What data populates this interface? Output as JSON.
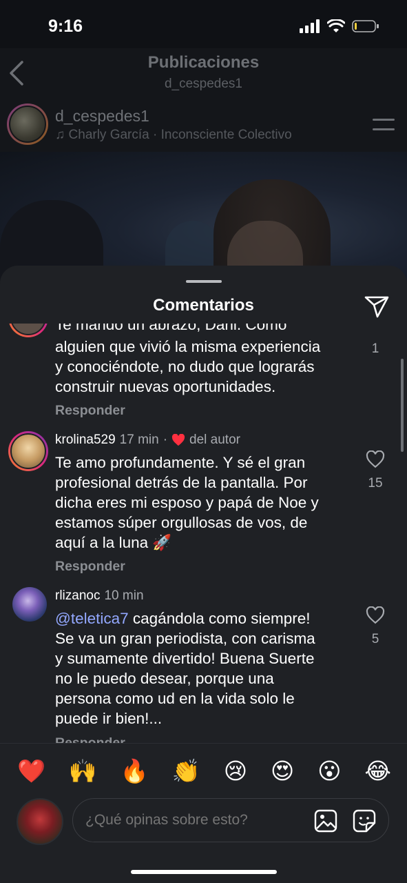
{
  "status": {
    "time": "9:16"
  },
  "header": {
    "title": "Publicaciones",
    "subtitle": "d_cespedes1"
  },
  "post": {
    "username": "d_cespedes1",
    "music": "Charly García · Inconsciente Colectivo"
  },
  "sheet": {
    "title": "Comentarios"
  },
  "comments": [
    {
      "partial_top": "Te mando un abrazo, Dani. Como",
      "lines": [
        "alguien que vivió la misma experiencia",
        "y conociéndote, no dudo que lograrás",
        "construir nuevas oportunidades."
      ],
      "reply": "Responder",
      "likes": "1"
    },
    {
      "username": "krolina529",
      "time": "17 min",
      "author_badge": "del autor",
      "lines": [
        "Te amo profundamente. Y sé el gran",
        "profesional detrás de la pantalla. Por",
        "dicha eres mi esposo y papá de Noe y",
        "estamos súper orgullosas de vos, de",
        "aquí a la luna 🚀"
      ],
      "reply": "Responder",
      "likes": "15"
    },
    {
      "username": "rlizanoc",
      "time": "10 min",
      "mention": "@teletica7",
      "first_line_rest": " cagándola como siempre!",
      "lines": [
        "Se va un gran periodista, con carisma",
        "y sumamente divertido! Buena Suerte",
        "no le puedo desear, porque una",
        "persona como ud en la vida solo le",
        "puede ir bien!..."
      ],
      "reply": "Responder",
      "likes": "5"
    }
  ],
  "emojis": [
    "❤️",
    "🙌",
    "🔥",
    "👏",
    "😢",
    "😍",
    "😮",
    "😂"
  ],
  "input": {
    "placeholder": "¿Qué opinas sobre esto?"
  },
  "colors": {
    "background": "#1f2125",
    "mention": "#93a8ff",
    "heart": "#ff3040",
    "muted": "#a8abb0"
  }
}
